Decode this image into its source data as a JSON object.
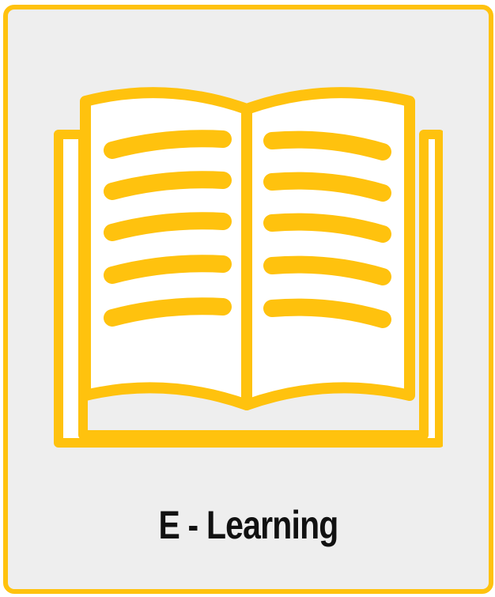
{
  "tile": {
    "label": "E - Learning",
    "icon": "open-book-icon"
  },
  "colors": {
    "accent": "#ffc20e",
    "background": "#eeeeee",
    "page": "#ffffff",
    "text": "#111111"
  }
}
